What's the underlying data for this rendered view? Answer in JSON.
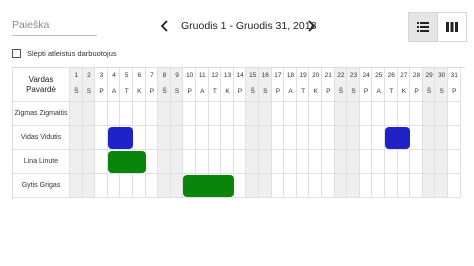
{
  "search": {
    "placeholder": "Paieška",
    "value": ""
  },
  "nav": {
    "prev_icon": "chevron-left-icon",
    "next_icon": "chevron-right-icon",
    "date_range": "Gruodis 1 - Gruodis 31, 2018"
  },
  "view_toggle": [
    {
      "icon": "list-icon",
      "active": true
    },
    {
      "icon": "columns-icon",
      "active": false
    }
  ],
  "hide_fired": {
    "label": "Slėpti atleistus darbuotojus",
    "checked": false
  },
  "header": {
    "name_line1": "Vardas",
    "name_line2": "Pavardė"
  },
  "days": [
    {
      "n": "1",
      "d": "Š",
      "we": true
    },
    {
      "n": "2",
      "d": "S",
      "we": true
    },
    {
      "n": "3",
      "d": "P",
      "we": false
    },
    {
      "n": "4",
      "d": "A",
      "we": false
    },
    {
      "n": "5",
      "d": "T",
      "we": false
    },
    {
      "n": "6",
      "d": "K",
      "we": false
    },
    {
      "n": "7",
      "d": "P",
      "we": false
    },
    {
      "n": "8",
      "d": "Š",
      "we": true
    },
    {
      "n": "9",
      "d": "S",
      "we": true
    },
    {
      "n": "10",
      "d": "P",
      "we": false
    },
    {
      "n": "11",
      "d": "A",
      "we": false
    },
    {
      "n": "12",
      "d": "T",
      "we": false
    },
    {
      "n": "13",
      "d": "K",
      "we": false
    },
    {
      "n": "14",
      "d": "P",
      "we": false
    },
    {
      "n": "15",
      "d": "Š",
      "we": true
    },
    {
      "n": "16",
      "d": "S",
      "we": true
    },
    {
      "n": "17",
      "d": "P",
      "we": false
    },
    {
      "n": "18",
      "d": "A",
      "we": false
    },
    {
      "n": "19",
      "d": "T",
      "we": false
    },
    {
      "n": "20",
      "d": "K",
      "we": false
    },
    {
      "n": "21",
      "d": "P",
      "we": false
    },
    {
      "n": "22",
      "d": "Š",
      "we": true
    },
    {
      "n": "23",
      "d": "S",
      "we": true
    },
    {
      "n": "24",
      "d": "P",
      "we": false
    },
    {
      "n": "25",
      "d": "A",
      "we": false
    },
    {
      "n": "26",
      "d": "T",
      "we": false
    },
    {
      "n": "27",
      "d": "K",
      "we": false
    },
    {
      "n": "28",
      "d": "P",
      "we": false
    },
    {
      "n": "29",
      "d": "Š",
      "we": true
    },
    {
      "n": "30",
      "d": "S",
      "we": true
    },
    {
      "n": "31",
      "d": "P",
      "we": false
    }
  ],
  "employees": [
    {
      "name": "Zigmas Zigmaitis",
      "absences": []
    },
    {
      "name": "Vidas Vidutis",
      "absences": [
        {
          "start": 4,
          "end": 5,
          "color": "#1f22c6"
        },
        {
          "start": 26,
          "end": 27,
          "color": "#1f22c6"
        }
      ]
    },
    {
      "name": "Lina Linute",
      "absences": [
        {
          "start": 4,
          "end": 6,
          "color": "#08850a"
        }
      ]
    },
    {
      "name": "Gytis Grigas",
      "absences": [
        {
          "start": 10,
          "end": 13,
          "color": "#08850a"
        }
      ]
    }
  ]
}
